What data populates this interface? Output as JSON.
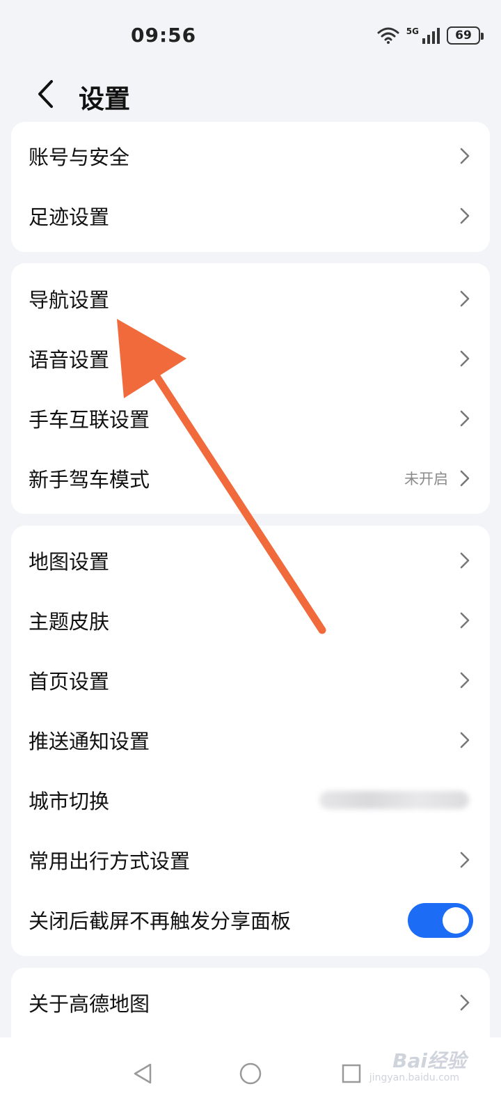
{
  "status_bar": {
    "time": "09:56",
    "network": "5G",
    "battery": "69",
    "icons": [
      "wifi-icon",
      "signal-icon",
      "battery-icon"
    ]
  },
  "header": {
    "title": "设置",
    "back_icon": "back-chevron-icon"
  },
  "groups": [
    {
      "items": [
        {
          "label": "账号与安全"
        },
        {
          "label": "足迹设置"
        }
      ]
    },
    {
      "items": [
        {
          "label": "导航设置"
        },
        {
          "label": "语音设置"
        },
        {
          "label": "手车互联设置"
        },
        {
          "label": "新手驾车模式",
          "value": "未开启"
        }
      ]
    },
    {
      "items": [
        {
          "label": "地图设置"
        },
        {
          "label": "主题皮肤"
        },
        {
          "label": "首页设置"
        },
        {
          "label": "推送通知设置"
        },
        {
          "label": "城市切换",
          "value_blurred": true
        },
        {
          "label": "常用出行方式设置"
        },
        {
          "label": "关闭后截屏不再触发分享面板",
          "toggle_on": true
        }
      ]
    },
    {
      "items": [
        {
          "label": "关于高德地图"
        }
      ]
    }
  ],
  "annotation": {
    "type": "arrow",
    "color": "#f06a3c",
    "points_to": "导航设置"
  },
  "navbar": {
    "buttons": [
      "back-triangle-icon",
      "home-circle-icon",
      "recents-square-icon"
    ]
  },
  "watermark": {
    "brand": "Bai经验",
    "sub": "jingyan.baidu.com"
  },
  "colors": {
    "accent": "#1c6cf5",
    "background": "#f3f4f7",
    "card": "#ffffff",
    "arrow": "#f06a3c"
  }
}
